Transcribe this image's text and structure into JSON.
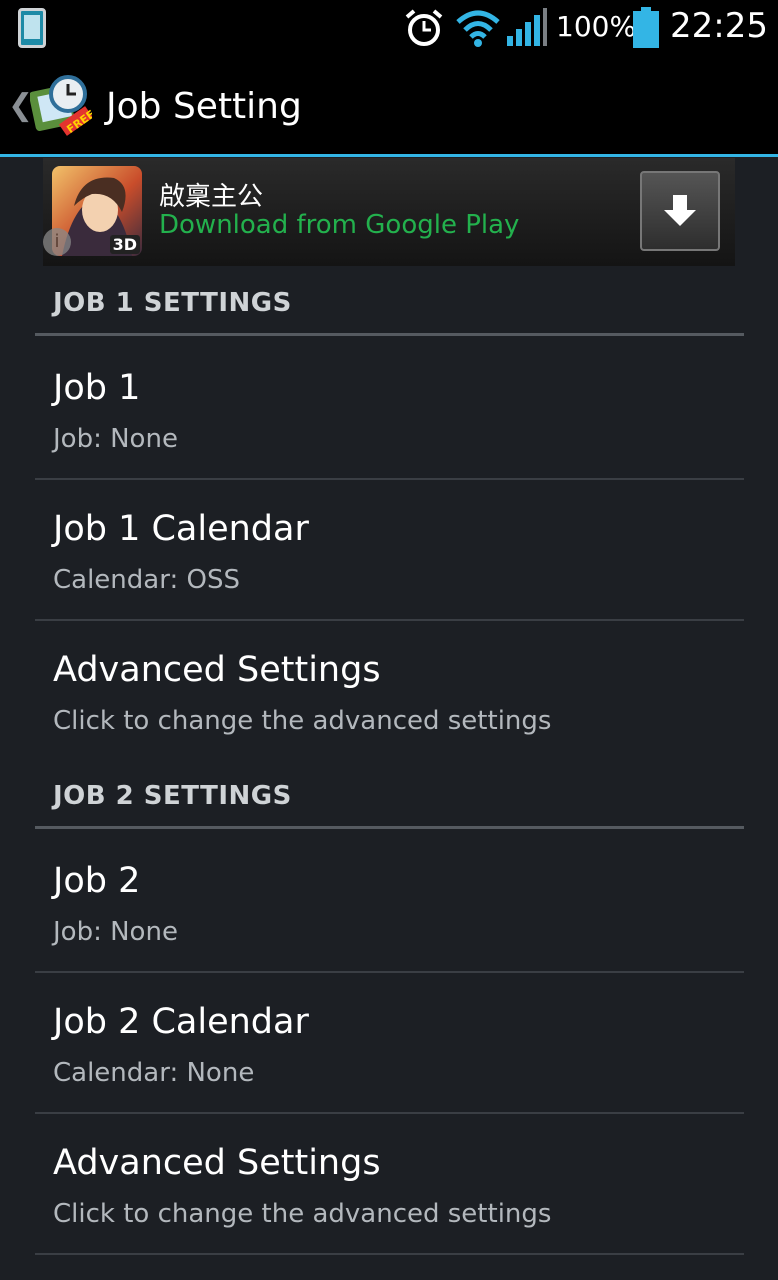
{
  "status_bar": {
    "battery_percent": "100%",
    "time": "22:25",
    "icons": [
      "phone-icon",
      "alarm-icon",
      "wifi-icon",
      "signal-icon",
      "battery-icon"
    ],
    "accent": "#33b5e5"
  },
  "action_bar": {
    "title": "Job Setting",
    "back_glyph": "❮",
    "logo_badge": "FREE"
  },
  "ad": {
    "title": "啟稟主公",
    "subtitle": "Download from Google Play",
    "thumb_badge": "3D",
    "info_glyph": "i",
    "subtitle_color": "#23b14d"
  },
  "sections": [
    {
      "header": "JOB 1 SETTINGS",
      "items": [
        {
          "title": "Job 1",
          "summary": "Job: None"
        },
        {
          "title": "Job 1 Calendar",
          "summary": "Calendar: OSS"
        },
        {
          "title": "Advanced Settings",
          "summary": "Click to change the advanced settings"
        }
      ]
    },
    {
      "header": "JOB 2 SETTINGS",
      "items": [
        {
          "title": "Job 2",
          "summary": "Job: None"
        },
        {
          "title": "Job 2 Calendar",
          "summary": "Calendar: None"
        },
        {
          "title": "Advanced Settings",
          "summary": "Click to change the advanced settings"
        }
      ]
    }
  ]
}
